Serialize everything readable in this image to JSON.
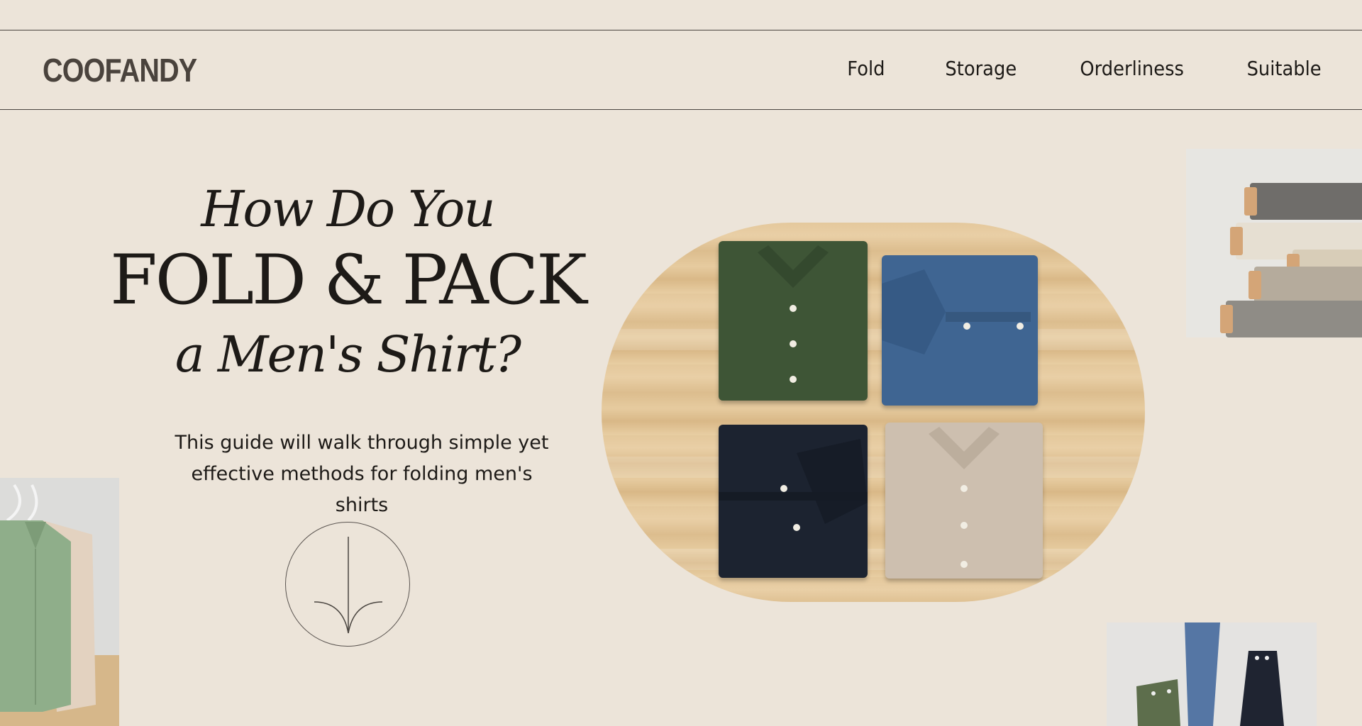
{
  "brand": {
    "logo_text": "COOFANDY"
  },
  "nav": {
    "items": [
      "Fold",
      "Storage",
      "Orderliness",
      "Suitable"
    ]
  },
  "hero": {
    "line1": "How Do You",
    "line2": "FOLD & PACK",
    "line3": "a Men's Shirt?",
    "subtitle_line1": "This guide will walk through simple yet",
    "subtitle_line2": "effective methods for folding men's shirts"
  },
  "icons": {
    "scroll": "arrow-down-icon"
  },
  "images": {
    "main": "four-folded-shirts-on-wood-image",
    "fabric": "fabric-rolls-image",
    "hanging": "hanging-shirts-image",
    "cuffs": "shirt-cuffs-image"
  },
  "colors": {
    "background": "#ece4d9",
    "text": "#1d1a17",
    "logo": "#4a433d",
    "shirt_green": "#3e5536",
    "shirt_blue": "#3f6592",
    "shirt_black": "#1c2330",
    "shirt_beige": "#cdbfaf"
  }
}
